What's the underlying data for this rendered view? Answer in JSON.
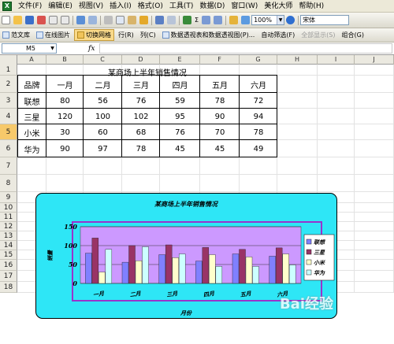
{
  "menubar": {
    "items": [
      "文件(F)",
      "编辑(E)",
      "视图(V)",
      "插入(I)",
      "格式(O)",
      "工具(T)",
      "数据(D)",
      "窗口(W)",
      "美化大师",
      "帮助(H)"
    ]
  },
  "toolbar1": {
    "zoom": "100%",
    "font": "宋体"
  },
  "toolbar2": {
    "buttons": [
      "范文库",
      "在线图片",
      "切换网格",
      "行(R)",
      "列(C)",
      "数据透视表和数据透视图(P)...",
      "自动筛选(F)",
      "全部显示(S)",
      "组合(G)"
    ]
  },
  "formula_bar": {
    "name_box": "M5",
    "fx": "fx"
  },
  "sheet": {
    "columns": [
      "A",
      "B",
      "C",
      "D",
      "E",
      "F",
      "G",
      "H",
      "I",
      "J"
    ],
    "rows": [
      "1",
      "2",
      "3",
      "4",
      "5",
      "6",
      "7",
      "8",
      "9",
      "10",
      "11",
      "12",
      "13",
      "14",
      "15",
      "16",
      "17",
      "18"
    ],
    "title": "某商场上半年销售情况",
    "header": [
      "品牌",
      "一月",
      "二月",
      "三月",
      "四月",
      "五月",
      "六月"
    ],
    "data": [
      [
        "联想",
        "80",
        "56",
        "76",
        "59",
        "78",
        "72"
      ],
      [
        "三星",
        "120",
        "100",
        "102",
        "95",
        "90",
        "94"
      ],
      [
        "小米",
        "30",
        "60",
        "68",
        "76",
        "70",
        "78"
      ],
      [
        "华为",
        "90",
        "97",
        "78",
        "45",
        "45",
        "49"
      ]
    ]
  },
  "chart_data": {
    "type": "bar",
    "title": "某商场上半年销售情况",
    "xlabel": "月份",
    "ylabel": "销量",
    "categories": [
      "一月",
      "二月",
      "三月",
      "四月",
      "五月",
      "六月"
    ],
    "series": [
      {
        "name": "联想",
        "values": [
          80,
          56,
          76,
          59,
          78,
          72
        ],
        "color": "#8080ff"
      },
      {
        "name": "三星",
        "values": [
          120,
          100,
          102,
          95,
          90,
          94
        ],
        "color": "#993366"
      },
      {
        "name": "小米",
        "values": [
          30,
          60,
          68,
          76,
          70,
          78
        ],
        "color": "#ffffcc"
      },
      {
        "name": "华为",
        "values": [
          90,
          97,
          78,
          45,
          45,
          49
        ],
        "color": "#ccffff"
      }
    ],
    "ylim": [
      0,
      150
    ],
    "yticks": [
      0,
      50,
      100,
      150
    ],
    "plot_background": "#cc99ff",
    "chart_background": "#33e8f8",
    "legend": "right",
    "grid": true
  },
  "watermark": "Bai经验"
}
